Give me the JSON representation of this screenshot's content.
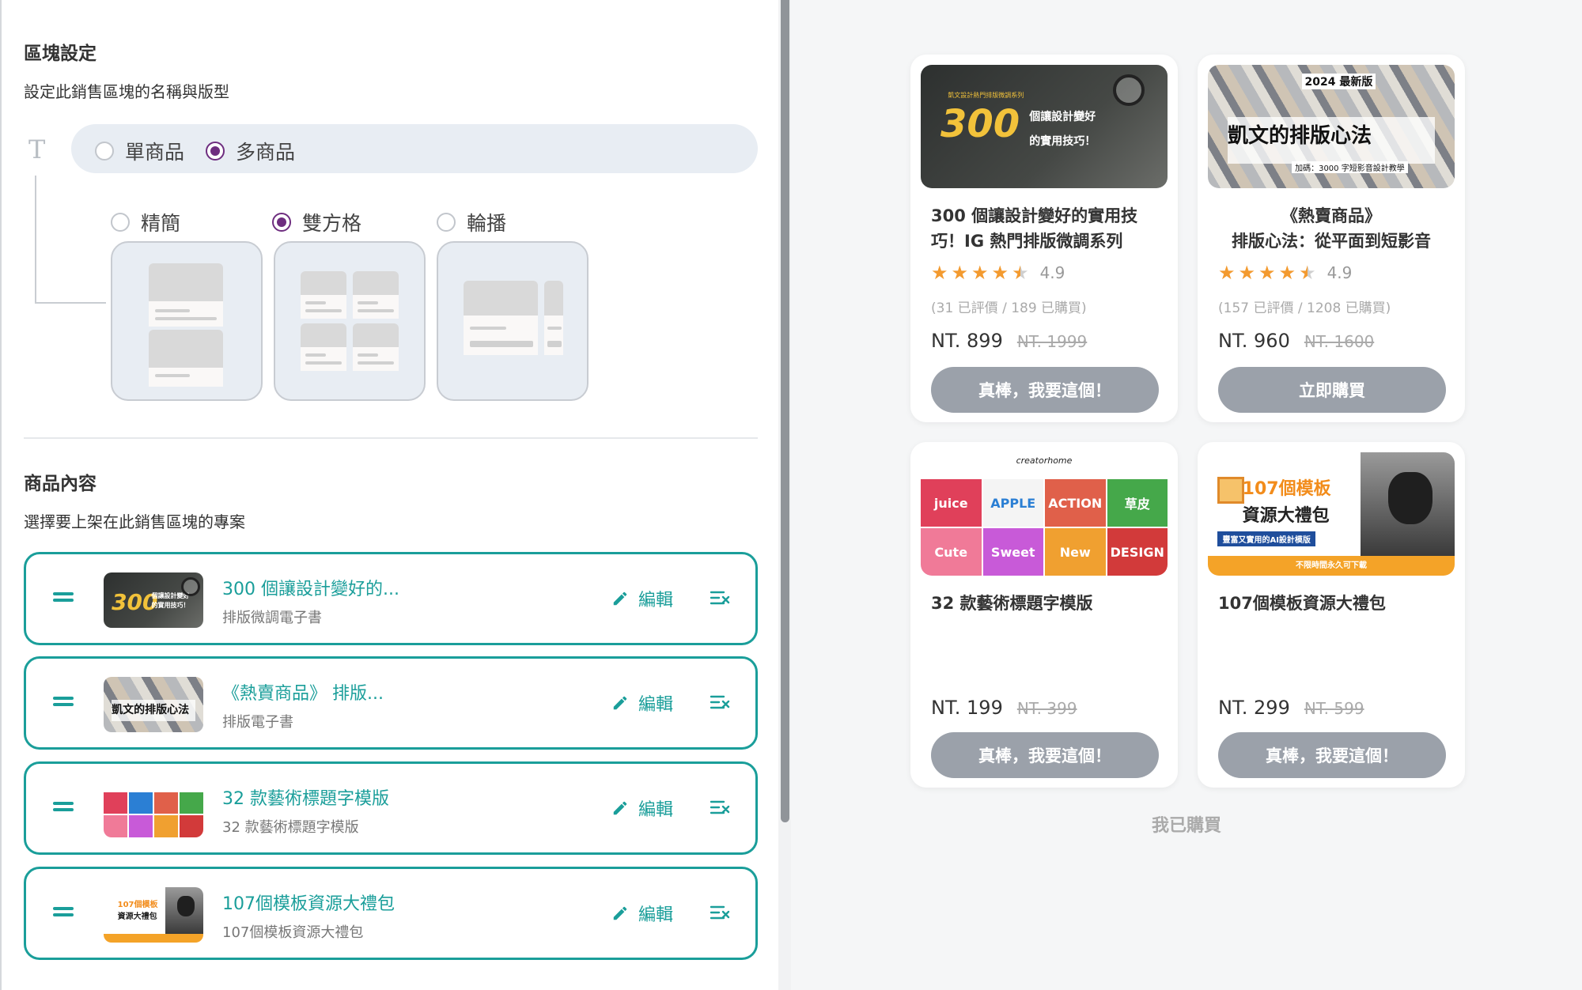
{
  "settings": {
    "title": "區塊設定",
    "subtitle": "設定此銷售區塊的名稱與版型",
    "type_options": [
      {
        "label": "單商品",
        "selected": false
      },
      {
        "label": "多商品",
        "selected": true
      }
    ],
    "layout_options": [
      {
        "label": "精簡",
        "selected": false
      },
      {
        "label": "雙方格",
        "selected": true
      },
      {
        "label": "輪播",
        "selected": false
      }
    ]
  },
  "content": {
    "title": "商品內容",
    "subtitle": "選擇要上架在此銷售區塊的專案",
    "edit_label": "編輯",
    "items": [
      {
        "title": "300 個讓設計變好的...",
        "subtitle": "排版微調電子書"
      },
      {
        "title": "《熱賣商品》 排版...",
        "subtitle": "排版電子書"
      },
      {
        "title": "32 款藝術標題字模版",
        "subtitle": "32 款藝術標題字模版"
      },
      {
        "title": "107個模板資源大禮包",
        "subtitle": "107個模板資源大禮包"
      }
    ]
  },
  "thumb_text": {
    "p1": {
      "header": "凱文設計熱門排版微調系列",
      "big": "300",
      "line1": "個讓設計變好",
      "line2": "的實用技巧！"
    },
    "p2": {
      "top": "2024 最新版",
      "main": "凱文的排版心法",
      "bottom": "加碼：3000 字短影音設計教學"
    },
    "p3": {
      "header": "creatorhome",
      "cells": [
        "juice",
        "APPLE",
        "ACTION",
        "草皮",
        "Cute",
        "Sweet",
        "New",
        "DESIGN"
      ]
    },
    "p4": {
      "line1": "107個模板",
      "line2": "資源大禮包",
      "tag": "豐富又實用的AI設計模版",
      "bar": "不限時間永久可下載"
    }
  },
  "preview": {
    "cards": [
      {
        "title": "300 個讓設計變好的實用技巧！IG 熱門排版微調系列",
        "rating": "4.9",
        "reviews": "(31 已評價 / 189 已購買)",
        "price": "NT. 899",
        "original_price": "NT. 1999",
        "button": "真棒，我要這個！"
      },
      {
        "title": "《熱賣商品》\n排版心法：從平面到短影音",
        "rating": "4.9",
        "reviews": "(157 已評價 / 1208 已購買)",
        "price": "NT. 960",
        "original_price": "NT. 1600",
        "button": "立即購買"
      },
      {
        "title": "32 款藝術標題字模版",
        "price": "NT. 199",
        "original_price": "NT. 399",
        "button": "真棒，我要這個！"
      },
      {
        "title": "107個模板資源大禮包",
        "price": "NT. 299",
        "original_price": "NT. 599",
        "button": "真棒，我要這個！"
      }
    ],
    "owned_link": "我已購買"
  },
  "colors": {
    "accent": "#1a9e9a",
    "radio_selected": "#6e2d7f",
    "button_gray": "#9ba1aa",
    "star": "#f39a2f"
  }
}
